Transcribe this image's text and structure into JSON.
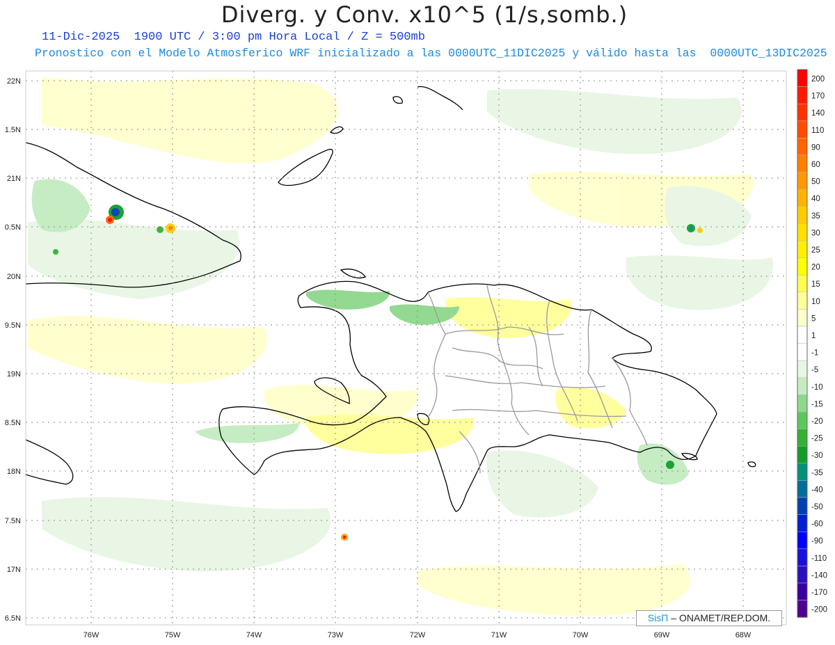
{
  "header": {
    "title": "Diverg. y Conv. x10^5 (1/s,somb.)",
    "subtitle1": "11-Dic-2025  1900 UTC / 3:00 pm Hora Local / Z = 500mb",
    "subtitle2": "Pronostico con el Modelo Atmosferico WRF inicializado a las 0000UTC_11DIC2025 y válido hasta las  0000UTC_13DIC2025"
  },
  "axes": {
    "lat_labels": [
      "22N",
      "1.5N",
      "21N",
      "0.5N",
      "20N",
      "9.5N",
      "19N",
      "8.5N",
      "18N",
      "7.5N",
      "17N",
      "6.5N"
    ],
    "lon_labels": [
      "76W",
      "75W",
      "74W",
      "73W",
      "72W",
      "71W",
      "70W",
      "69W",
      "68W"
    ]
  },
  "colorbar": {
    "labels": [
      "200",
      "170",
      "140",
      "110",
      "90",
      "60",
      "50",
      "40",
      "35",
      "30",
      "25",
      "20",
      "15",
      "10",
      "5",
      "1",
      "-1",
      "-5",
      "-10",
      "-15",
      "-20",
      "-25",
      "-30",
      "-35",
      "-40",
      "-50",
      "-60",
      "-90",
      "-110",
      "-140",
      "-170",
      "-200"
    ],
    "colors": [
      "#ff0000",
      "#ff1a00",
      "#ff3300",
      "#ff4d00",
      "#ff6600",
      "#ff8000",
      "#ff9900",
      "#ffb300",
      "#ffcc00",
      "#ffe000",
      "#fff000",
      "#ffff00",
      "#ffff50",
      "#ffff99",
      "#ffffcc",
      "#ffffff",
      "#ffffff",
      "#e8f6e4",
      "#c4ecc0",
      "#8ed88c",
      "#5cc75c",
      "#34b034",
      "#129c2a",
      "#00907a",
      "#006e9a",
      "#0040b0",
      "#0020d0",
      "#0000ff",
      "#1a10dd",
      "#2a10c0",
      "#3a00a0",
      "#500090"
    ]
  },
  "credit": {
    "brand": "SisΠ",
    "org": "– ONAMET/REP.DOM."
  }
}
